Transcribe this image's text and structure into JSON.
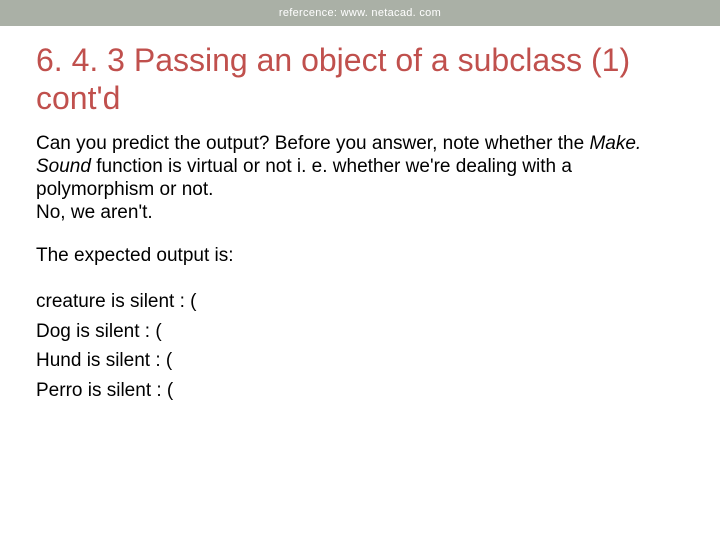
{
  "header": {
    "reference": "refercence: www. netacad. com"
  },
  "title": "6. 4. 3 Passing an object of a subclass (1) cont'd",
  "body": {
    "line1_pre": "Can you predict the output? Before you answer, note whether the ",
    "line1_em": "Make. Sound",
    "line1_post": " function is virtual or not i. e. whether we're dealing with a polymorphism or not.",
    "line2": "No, we aren't.",
    "expected_label": "The expected output is:"
  },
  "output": [
    "creature is silent : (",
    "Dog is silent : (",
    "Hund is silent : (",
    "Perro is silent : ("
  ]
}
